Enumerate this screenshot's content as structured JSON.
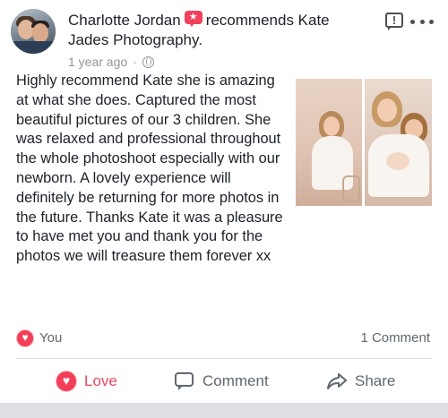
{
  "post": {
    "author_name": "Charlotte Jordan",
    "action_text": "recommends Kate Jades Photography.",
    "timestamp": "1 year ago",
    "separator": "·",
    "privacy_icon": "globe-icon",
    "recommend_icon": "recommend-star-icon",
    "review_text": "Highly recommend Kate she is amazing at what she does. Captured the most beautiful pictures of our 3 children. She was relaxed and professional throughout the whole photoshoot especially with our newborn.  A lovely experience will definitely be returning for more photos in the future. Thanks Kate it was a pleasure to have met you and thank you for the photos we will treasure them forever xx"
  },
  "header_actions": {
    "report_icon": "report-icon",
    "more_icon": "more-options-icon"
  },
  "reactions": {
    "reaction_icon": "love-reaction-icon",
    "you_label": "You",
    "comment_count": "1 Comment"
  },
  "actions": {
    "love_label": "Love",
    "comment_label": "Comment",
    "share_label": "Share"
  },
  "colors": {
    "love_red": "#f33e58",
    "love_text": "#e9485e",
    "secondary_text": "#616770",
    "meta_text": "#90949c",
    "primary_text": "#1d2129"
  }
}
